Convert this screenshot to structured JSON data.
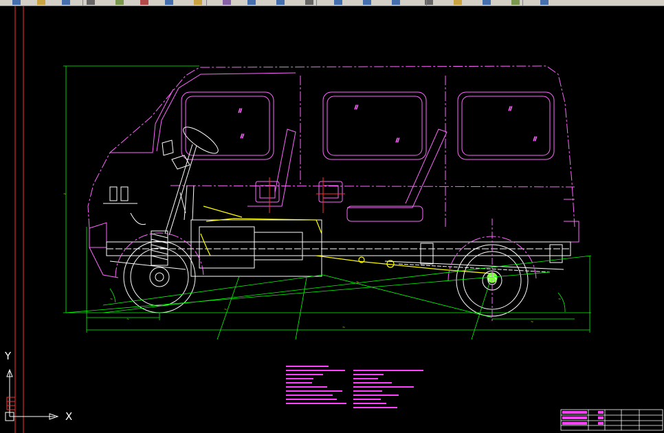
{
  "toolbar": {
    "icons": [
      "new-file-icon",
      "open-icon",
      "save-icon",
      "print-icon",
      "preview-icon",
      "cut-icon",
      "copy-icon",
      "paste-icon",
      "match-icon",
      "undo-icon",
      "redo-icon",
      "pan-icon",
      "zoom-icon",
      "zoom-window-icon",
      "zoom-prev-icon",
      "properties-icon",
      "design-center-icon",
      "tool-palette-icon",
      "layer-icon",
      "help-icon"
    ]
  },
  "ucs": {
    "x_label": "X",
    "y_label": "Y"
  },
  "colors": {
    "background": "#000000",
    "vehicle_body": "#ff66ff",
    "chassis": "#ffffff",
    "dimensions": "#00ff00",
    "highlight": "#ffff00",
    "notes": "#ff40ff",
    "leaders": "#00ff00",
    "border": "#ff0000",
    "title_block": "#ffffff"
  }
}
